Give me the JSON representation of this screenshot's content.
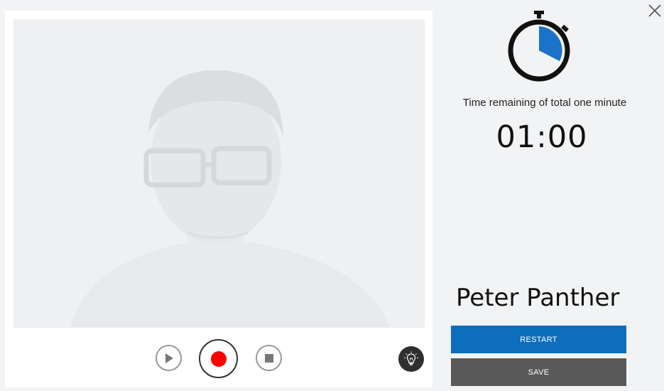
{
  "timer": {
    "caption": "Time remaining of total one minute",
    "value": "01:00"
  },
  "person": {
    "name": "Peter Panther"
  },
  "buttons": {
    "restart_label": "RESTART",
    "save_label": "SAVE"
  },
  "controls": {
    "play": "play-icon",
    "record": "record-icon",
    "stop": "stop-icon",
    "tip": "lightbulb-icon",
    "close": "close-icon"
  },
  "colors": {
    "accent": "#0d6ebd",
    "save": "#595959",
    "record": "#ff0000",
    "stopwatch_fill": "#1a73c8"
  }
}
